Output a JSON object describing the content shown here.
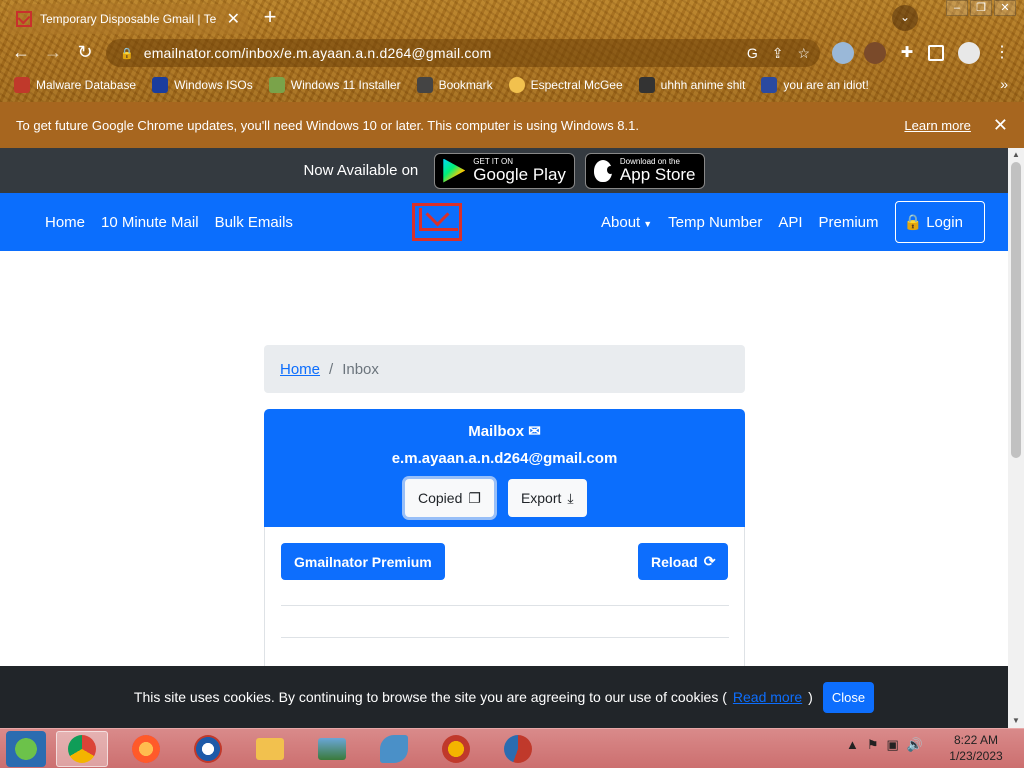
{
  "browser": {
    "tab_title": "Temporary Disposable Gmail | Te",
    "url": "emailnator.com/inbox/e.m.ayaan.a.n.d264@gmail.com",
    "bookmarks": [
      {
        "label": "Malware Database",
        "icon": "red-shield-icon",
        "color": "#c0392b"
      },
      {
        "label": "Windows ISOs",
        "icon": "x-logo-icon",
        "color": "#1a3d9e"
      },
      {
        "label": "Windows 11 Installer",
        "icon": "image-icon",
        "color": "#7aa34a"
      },
      {
        "label": "Bookmark",
        "icon": "figure-icon",
        "color": "#444444"
      },
      {
        "label": "Espectral McGee",
        "icon": "face-icon",
        "color": "#f2c14e"
      },
      {
        "label": "uhhh anime shit",
        "icon": "anime-icon",
        "color": "#333333"
      },
      {
        "label": "you are an idiot!",
        "icon": "uk-flag-icon",
        "color": "#2b4aa0"
      }
    ],
    "more_bookmarks": "»",
    "infobar_text": "To get future Google Chrome updates, you'll need Windows 10 or later. This computer is using Windows 8.1.",
    "infobar_link": "Learn more"
  },
  "app_strip": {
    "label": "Now Available on",
    "google_small": "GET IT ON",
    "google_big": "Google Play",
    "apple_small": "Download on the",
    "apple_big": "App Store"
  },
  "navbar": {
    "left": [
      "Home",
      "10 Minute Mail",
      "Bulk Emails"
    ],
    "about": "About",
    "temp_number": "Temp Number",
    "api": "API",
    "premium": "Premium",
    "login": "Login"
  },
  "breadcrumb": {
    "home": "Home",
    "sep": "/",
    "current": "Inbox"
  },
  "mailbox": {
    "title": "Mailbox",
    "email": "e.m.ayaan.a.n.d264@gmail.com",
    "copied": "Copied",
    "export": "Export"
  },
  "panel": {
    "premium_btn": "Gmailnator Premium",
    "reload_btn": "Reload"
  },
  "cookie": {
    "text": "This site uses cookies. By continuing to browse the site you are agreeing to our use of cookies (",
    "link": "Read more",
    "close_paren": ")",
    "close": "Close"
  },
  "taskbar": {
    "time": "8:22 AM",
    "date": "1/23/2023"
  }
}
